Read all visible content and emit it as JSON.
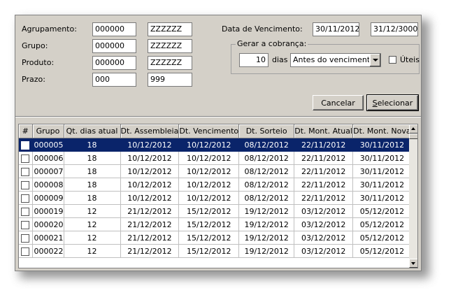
{
  "form": {
    "agrupamento": {
      "label": "Agrupamento:",
      "from": "000000",
      "to": "ZZZZZZ"
    },
    "grupo": {
      "label": "Grupo:",
      "from": "000000",
      "to": "ZZZZZZ"
    },
    "produto": {
      "label": "Produto:",
      "from": "000000",
      "to": "ZZZZZZ"
    },
    "prazo": {
      "label": "Prazo:",
      "from": "000",
      "to": "999"
    },
    "data_vencimento": {
      "label": "Data de Vencimento:",
      "from": "30/11/2012",
      "to": "31/12/3000"
    },
    "gerar_cobranca": {
      "legend": "Gerar a cobrança:",
      "days_value": "10",
      "days_label": "dias",
      "when_selected": "Antes do vencimento",
      "uteis_label": "Úteis",
      "uteis_checked": false
    }
  },
  "buttons": {
    "cancel": "Cancelar",
    "select_prefix": "",
    "select_underlined": "S",
    "select_rest": "elecionar"
  },
  "grid": {
    "columns": [
      "#",
      "Grupo",
      "Qt. dias atual",
      "Dt. Assembleia",
      "Dt. Vencimento",
      "Dt. Sorteio",
      "Dt. Mont. Atual",
      "Dt. Mont. Nova"
    ],
    "selected_row_index": 0,
    "rows": [
      [
        "000005",
        "18",
        "10/12/2012",
        "10/12/2012",
        "08/12/2012",
        "22/11/2012",
        "30/11/2012"
      ],
      [
        "000006",
        "18",
        "10/12/2012",
        "10/12/2012",
        "08/12/2012",
        "22/11/2012",
        "30/11/2012"
      ],
      [
        "000007",
        "18",
        "10/12/2012",
        "10/12/2012",
        "08/12/2012",
        "22/11/2012",
        "30/11/2012"
      ],
      [
        "000008",
        "18",
        "10/12/2012",
        "10/12/2012",
        "08/12/2012",
        "22/11/2012",
        "30/11/2012"
      ],
      [
        "000009",
        "18",
        "10/12/2012",
        "10/12/2012",
        "08/12/2012",
        "22/11/2012",
        "30/11/2012"
      ],
      [
        "000019",
        "12",
        "21/12/2012",
        "15/12/2012",
        "19/12/2012",
        "03/12/2012",
        "05/12/2012"
      ],
      [
        "000020",
        "12",
        "21/12/2012",
        "15/12/2012",
        "19/12/2012",
        "03/12/2012",
        "05/12/2012"
      ],
      [
        "000021",
        "12",
        "21/12/2012",
        "15/12/2012",
        "19/12/2012",
        "03/12/2012",
        "05/12/2012"
      ],
      [
        "000022",
        "12",
        "21/12/2012",
        "15/12/2012",
        "19/12/2012",
        "03/12/2012",
        "05/12/2012"
      ]
    ]
  },
  "colors": {
    "window_bg": "#d4d0c8",
    "selection": "#0a246a"
  }
}
